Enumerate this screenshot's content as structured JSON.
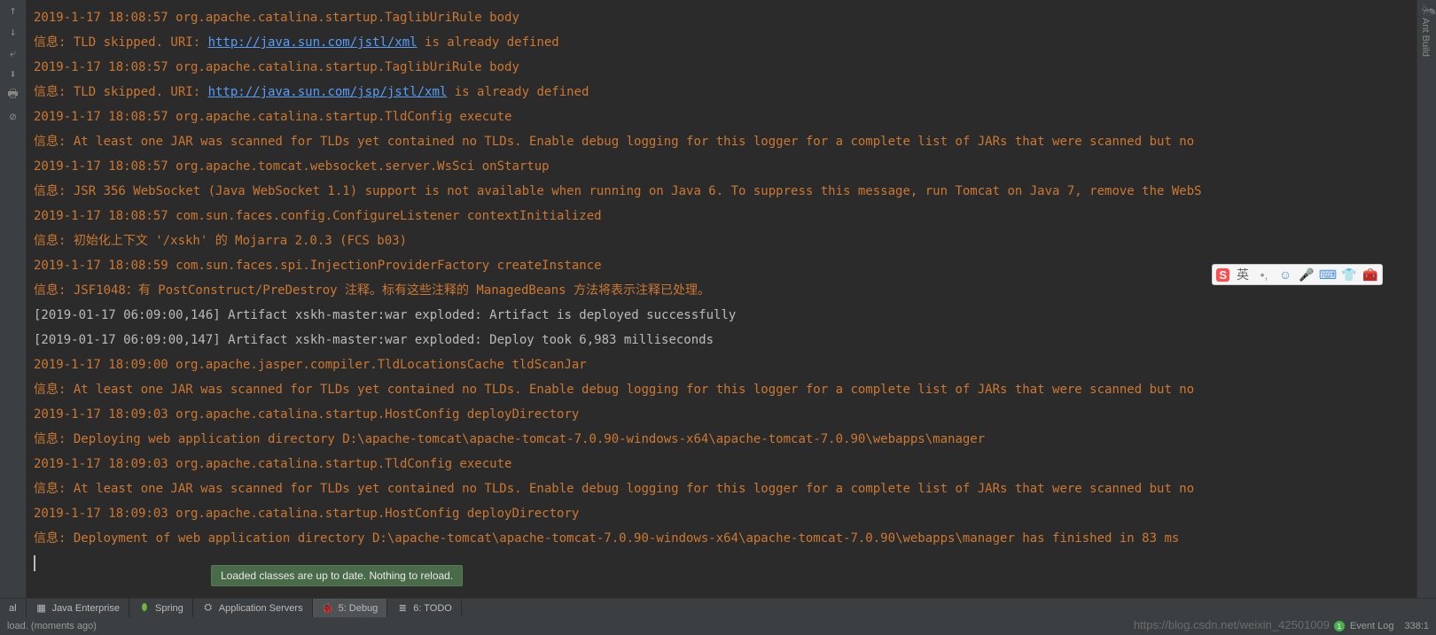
{
  "console": {
    "lines": [
      {
        "type": "log",
        "text": "2019-1-17 18:08:57 org.apache.catalina.startup.TaglibUriRule body"
      },
      {
        "type": "info-link",
        "prefix": "信息: TLD skipped. URI: ",
        "link": "http://java.sun.com/jstl/xml",
        "suffix": " is already defined"
      },
      {
        "type": "log",
        "text": "2019-1-17 18:08:57 org.apache.catalina.startup.TaglibUriRule body"
      },
      {
        "type": "info-link",
        "prefix": "信息: TLD skipped. URI: ",
        "link": "http://java.sun.com/jsp/jstl/xml",
        "suffix": " is already defined"
      },
      {
        "type": "log",
        "text": "2019-1-17 18:08:57 org.apache.catalina.startup.TldConfig execute"
      },
      {
        "type": "info",
        "text": "信息: At least one JAR was scanned for TLDs yet contained no TLDs. Enable debug logging for this logger for a complete list of JARs that were scanned but no"
      },
      {
        "type": "log",
        "text": "2019-1-17 18:08:57 org.apache.tomcat.websocket.server.WsSci onStartup"
      },
      {
        "type": "info",
        "text": "信息: JSR 356 WebSocket (Java WebSocket 1.1) support is not available when running on Java 6. To suppress this message, run Tomcat on Java 7, remove the WebS"
      },
      {
        "type": "log",
        "text": "2019-1-17 18:08:57 com.sun.faces.config.ConfigureListener contextInitialized"
      },
      {
        "type": "info",
        "text": "信息: 初始化上下文 '/xskh' 的 Mojarra 2.0.3 (FCS b03)"
      },
      {
        "type": "log",
        "text": "2019-1-17 18:08:59 com.sun.faces.spi.InjectionProviderFactory createInstance"
      },
      {
        "type": "info",
        "text": "信息: JSF1048：有 PostConstruct/PreDestroy 注释。标有这些注释的 ManagedBeans 方法将表示注释已处理。"
      },
      {
        "type": "white",
        "text": "[2019-01-17 06:09:00,146] Artifact xskh-master:war exploded: Artifact is deployed successfully"
      },
      {
        "type": "white",
        "text": "[2019-01-17 06:09:00,147] Artifact xskh-master:war exploded: Deploy took 6,983 milliseconds"
      },
      {
        "type": "log",
        "text": "2019-1-17 18:09:00 org.apache.jasper.compiler.TldLocationsCache tldScanJar"
      },
      {
        "type": "info",
        "text": "信息: At least one JAR was scanned for TLDs yet contained no TLDs. Enable debug logging for this logger for a complete list of JARs that were scanned but no"
      },
      {
        "type": "log",
        "text": "2019-1-17 18:09:03 org.apache.catalina.startup.HostConfig deployDirectory"
      },
      {
        "type": "info",
        "text": "信息: Deploying web application directory D:\\apache-tomcat\\apache-tomcat-7.0.90-windows-x64\\apache-tomcat-7.0.90\\webapps\\manager"
      },
      {
        "type": "log",
        "text": "2019-1-17 18:09:03 org.apache.catalina.startup.TldConfig execute"
      },
      {
        "type": "info",
        "text": "信息: At least one JAR was scanned for TLDs yet contained no TLDs. Enable debug logging for this logger for a complete list of JARs that were scanned but no"
      },
      {
        "type": "log",
        "text": "2019-1-17 18:09:03 org.apache.catalina.startup.HostConfig deployDirectory"
      },
      {
        "type": "info",
        "text": "信息: Deployment of web application directory D:\\apache-tomcat\\apache-tomcat-7.0.90-windows-x64\\apache-tomcat-7.0.90\\webapps\\manager has finished in 83 ms"
      }
    ]
  },
  "tooltip": {
    "text": "Loaded classes are up to date. Nothing to reload."
  },
  "tabs": {
    "terminal": "al",
    "java_enterprise": "Java Enterprise",
    "spring": "Spring",
    "app_servers": "Application Servers",
    "debug": "5: Debug",
    "todo": "6: TODO"
  },
  "status": {
    "left": "load. (moments ago)",
    "event_log": "Event Log",
    "position": "338:1"
  },
  "right_sidebar": {
    "label": "Ant Build"
  },
  "ime": {
    "lang": "英"
  },
  "watermark": "https://blog.csdn.net/weixin_42501009"
}
